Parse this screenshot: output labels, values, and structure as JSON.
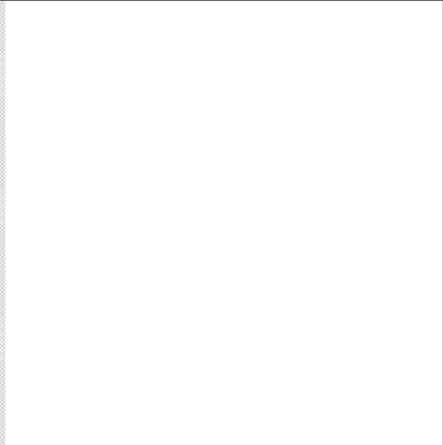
{
  "window": {
    "background": "#ffffff",
    "border_color": "#5a5a5a"
  },
  "panel": {
    "resize_grip": "splitter-grip"
  }
}
